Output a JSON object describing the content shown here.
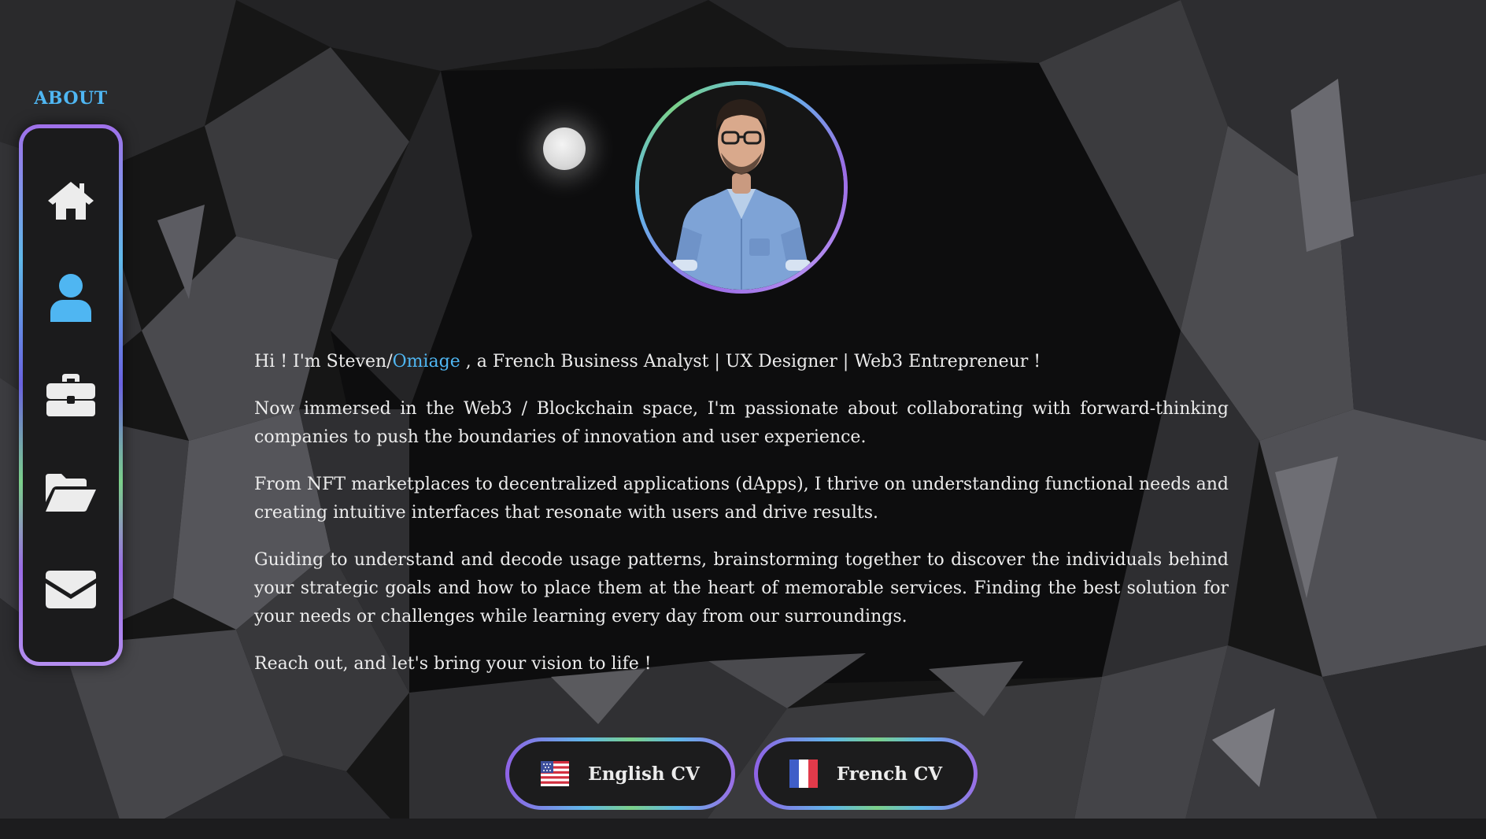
{
  "sidebar": {
    "title": "ABOUT",
    "items": [
      {
        "icon": "home-icon",
        "active": false
      },
      {
        "icon": "user-icon",
        "active": true
      },
      {
        "icon": "briefcase-icon",
        "active": false
      },
      {
        "icon": "folder-open-icon",
        "active": false
      },
      {
        "icon": "envelope-icon",
        "active": false
      }
    ]
  },
  "colors": {
    "accent": "#4fb6f2",
    "icon": "#ececec",
    "panel": "#1b1b1c"
  },
  "intro": {
    "before": "Hi ! I'm Steven/",
    "highlight": "Omiage",
    "after": " , a French Business Analyst | UX Designer | Web3 Entrepreneur !"
  },
  "paragraphs": [
    "Now immersed in the Web3 / Blockchain space, I'm passionate about collaborating with forward-thinking companies to push the boundaries of innovation and user experience.",
    "From NFT marketplaces to decentralized applications (dApps), I thrive on understanding functional needs and creating intuitive interfaces that resonate with users and drive results.",
    "Guiding to understand and decode usage patterns, brainstorming together to discover the individuals behind your strategic goals and how to place them at the heart of memorable services. Finding the best solution for your needs or challenges while learning every day from our surroundings.",
    "Reach out, and let's bring your vision to life !"
  ],
  "buttons": {
    "english": {
      "label": "English CV",
      "icon": "us-flag-icon"
    },
    "french": {
      "label": "French CV",
      "icon": "fr-flag-icon"
    }
  }
}
